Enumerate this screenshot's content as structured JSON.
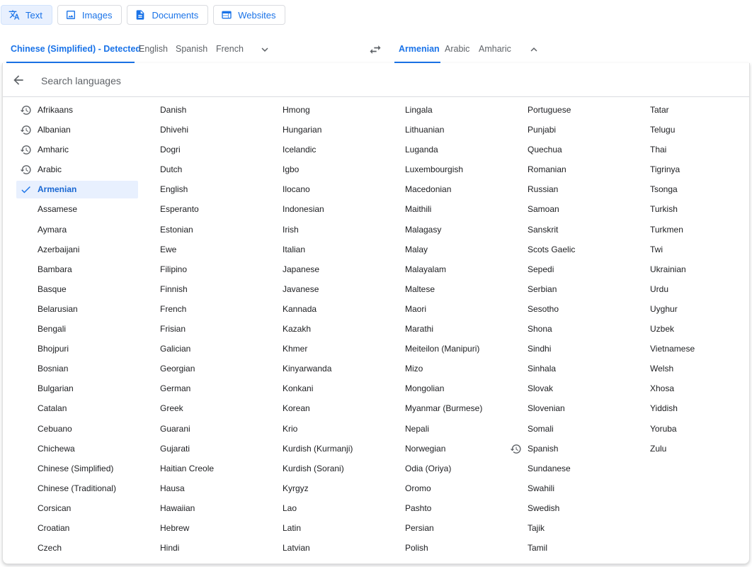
{
  "modes": [
    {
      "label": "Text",
      "icon": "translate-icon",
      "active": true
    },
    {
      "label": "Images",
      "icon": "image-icon",
      "active": false
    },
    {
      "label": "Documents",
      "icon": "document-icon",
      "active": false
    },
    {
      "label": "Websites",
      "icon": "website-icon",
      "active": false
    }
  ],
  "source_tabs": [
    "Chinese (Simplified) - Detected",
    "English",
    "Spanish",
    "French"
  ],
  "target_tabs": [
    "Armenian",
    "Arabic",
    "Amharic"
  ],
  "search": {
    "placeholder": "Search languages"
  },
  "languages": [
    [
      "Afrikaans",
      "Albanian",
      "Amharic",
      "Arabic",
      "Armenian",
      "Assamese",
      "Aymara",
      "Azerbaijani",
      "Bambara",
      "Basque",
      "Belarusian",
      "Bengali",
      "Bhojpuri",
      "Bosnian",
      "Bulgarian",
      "Catalan",
      "Cebuano",
      "Chichewa",
      "Chinese (Simplified)",
      "Chinese (Traditional)",
      "Corsican",
      "Croatian",
      "Czech"
    ],
    [
      "Danish",
      "Dhivehi",
      "Dogri",
      "Dutch",
      "English",
      "Esperanto",
      "Estonian",
      "Ewe",
      "Filipino",
      "Finnish",
      "French",
      "Frisian",
      "Galician",
      "Georgian",
      "German",
      "Greek",
      "Guarani",
      "Gujarati",
      "Haitian Creole",
      "Hausa",
      "Hawaiian",
      "Hebrew",
      "Hindi"
    ],
    [
      "Hmong",
      "Hungarian",
      "Icelandic",
      "Igbo",
      "Ilocano",
      "Indonesian",
      "Irish",
      "Italian",
      "Japanese",
      "Javanese",
      "Kannada",
      "Kazakh",
      "Khmer",
      "Kinyarwanda",
      "Konkani",
      "Korean",
      "Krio",
      "Kurdish (Kurmanji)",
      "Kurdish (Sorani)",
      "Kyrgyz",
      "Lao",
      "Latin",
      "Latvian"
    ],
    [
      "Lingala",
      "Lithuanian",
      "Luganda",
      "Luxembourgish",
      "Macedonian",
      "Maithili",
      "Malagasy",
      "Malay",
      "Malayalam",
      "Maltese",
      "Maori",
      "Marathi",
      "Meiteilon (Manipuri)",
      "Mizo",
      "Mongolian",
      "Myanmar (Burmese)",
      "Nepali",
      "Norwegian",
      "Odia (Oriya)",
      "Oromo",
      "Pashto",
      "Persian",
      "Polish"
    ],
    [
      "Portuguese",
      "Punjabi",
      "Quechua",
      "Romanian",
      "Russian",
      "Samoan",
      "Sanskrit",
      "Scots Gaelic",
      "Sepedi",
      "Serbian",
      "Sesotho",
      "Shona",
      "Sindhi",
      "Sinhala",
      "Slovak",
      "Slovenian",
      "Somali",
      "Spanish",
      "Sundanese",
      "Swahili",
      "Swedish",
      "Tajik",
      "Tamil"
    ],
    [
      "Tatar",
      "Telugu",
      "Thai",
      "Tigrinya",
      "Tsonga",
      "Turkish",
      "Turkmen",
      "Twi",
      "Ukrainian",
      "Urdu",
      "Uyghur",
      "Uzbek",
      "Vietnamese",
      "Welsh",
      "Xhosa",
      "Yiddish",
      "Yoruba",
      "Zulu"
    ]
  ],
  "recent": [
    "Afrikaans",
    "Albanian",
    "Amharic",
    "Arabic",
    "Spanish"
  ],
  "selected": "Armenian",
  "colors": {
    "accent": "#1a73e8",
    "selected_bg": "#e8f0fe"
  }
}
